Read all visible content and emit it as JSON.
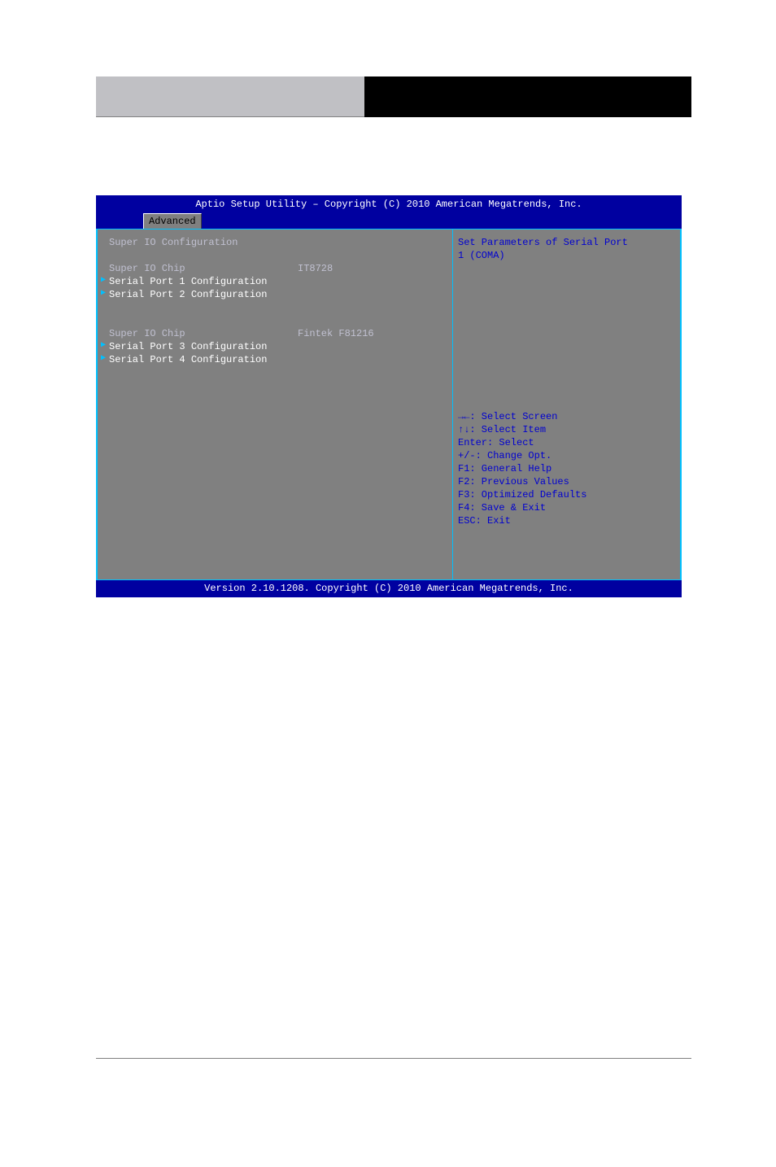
{
  "bios": {
    "title": "Aptio Setup Utility – Copyright (C) 2010 American Megatrends, Inc.",
    "tab": "Advanced",
    "section_title": "Super IO Configuration",
    "chip1_label": "Super IO Chip",
    "chip1_value": "IT8728",
    "sp1": "Serial Port 1 Configuration",
    "sp2": "Serial Port 2 Configuration",
    "chip2_label": "Super IO Chip",
    "chip2_value": "Fintek F81216",
    "sp3": "Serial Port 3 Configuration",
    "sp4": "Serial Port 4 Configuration",
    "help_line1": "Set Parameters of Serial Port",
    "help_line2": "1 (COMA)",
    "nav": {
      "l1": "→←: Select Screen",
      "l2": "↑↓: Select Item",
      "l3": "Enter: Select",
      "l4": "+/-: Change Opt.",
      "l5": "F1: General Help",
      "l6": "F2: Previous Values",
      "l7": "F3: Optimized Defaults",
      "l8": "F4: Save & Exit",
      "l9": "ESC: Exit"
    },
    "footer": "Version 2.10.1208. Copyright (C) 2010 American Megatrends, Inc."
  }
}
